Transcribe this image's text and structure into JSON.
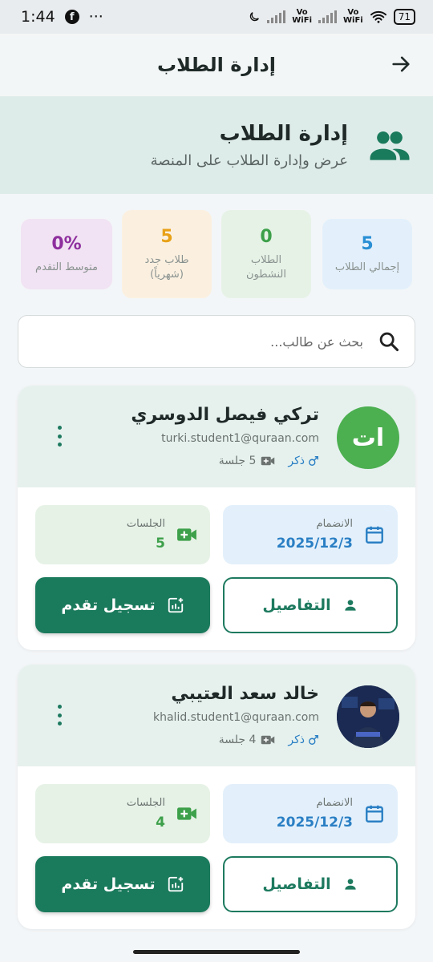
{
  "status_bar": {
    "time": "1:44",
    "dots": "···",
    "vo_top": "Vo",
    "vo_bottom": "WiFi",
    "battery": "71"
  },
  "app_bar": {
    "title": "إدارة الطلاب",
    "back_icon": "arrow-right-icon"
  },
  "header": {
    "title": "إدارة الطلاب",
    "subtitle": "عرض وإدارة الطلاب على المنصة",
    "icon": "users-icon"
  },
  "stats": [
    {
      "value": "5",
      "label": "إجمالي الطلاب",
      "color": "#2a8fd4",
      "bg": "#e3f0fb"
    },
    {
      "value": "0",
      "label": "الطلاب النشطون",
      "color": "#3da04a",
      "bg": "#e6f2e6"
    },
    {
      "value": "5",
      "label": "طلاب جدد (شهرياً)",
      "color": "#e8a117",
      "bg": "#fbf0e0"
    },
    {
      "value": "0%",
      "label": "متوسط التقدم",
      "color": "#8e2f9e",
      "bg": "#f1e3f3"
    }
  ],
  "search": {
    "placeholder": "بحث عن طالب..."
  },
  "students": [
    {
      "name": "تركي فيصل الدوسري",
      "email": "turki.student1@quraan.com",
      "gender": "ذكر",
      "sessions_meta": "5 جلسة",
      "avatar_initials": "ات",
      "join_label": "الانضمام",
      "join_date": "2025/12/3",
      "sessions_label": "الجلسات",
      "sessions_count": "5",
      "details_label": "التفاصيل",
      "progress_label": "تسجيل تقدم"
    },
    {
      "name": "خالد سعد العتيبي",
      "email": "khalid.student1@quraan.com",
      "gender": "ذكر",
      "sessions_meta": "4 جلسة",
      "avatar_initials": "",
      "join_label": "الانضمام",
      "join_date": "2025/12/3",
      "sessions_label": "الجلسات",
      "sessions_count": "4",
      "details_label": "التفاصيل",
      "progress_label": "تسجيل تقدم"
    }
  ],
  "colors": {
    "primary": "#1a7a5c",
    "avatar_green": "#4caf50",
    "join_blue": "#2a7fc4",
    "session_green": "#3da04a"
  }
}
